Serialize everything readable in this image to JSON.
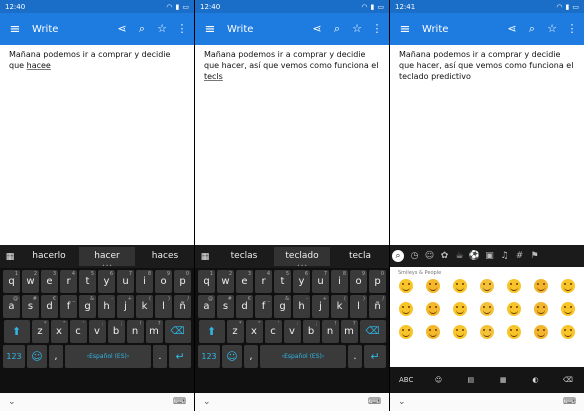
{
  "app": {
    "title": "Write"
  },
  "colors": {
    "statusbar": "#1a6ec8",
    "appbar": "#1e7be0",
    "keyboard": "#101010",
    "key": "#3a3a3a",
    "accent": "#2fb7e6"
  },
  "icons": {
    "menu": "hamburger-menu-icon",
    "share": "share-icon",
    "search": "search-icon",
    "star": "star-icon",
    "more": "more-vert-icon"
  },
  "panels": [
    {
      "time": "12:40",
      "text_prefix": "Mañana podemos ir a comprar y decidie que ",
      "text_last": "hacee",
      "suggestions": [
        "hacerlo",
        "hacer",
        "haces"
      ]
    },
    {
      "time": "12:40",
      "text_prefix": "Mañana podemos ir a comprar y decidie que hacer, así que vemos como funciona el ",
      "text_last": "tecls",
      "suggestions": [
        "teclas",
        "teclado",
        "tecla"
      ]
    },
    {
      "time": "12:41",
      "text_prefix": "Mañana podemos ir a comprar y decidie que hacer, así que vemos como funciona el teclado predictivo",
      "text_last": "",
      "emoji_section": "Smileys & People",
      "emoji_bottom": {
        "abc": "ABC"
      }
    }
  ],
  "keyboard": {
    "row1": [
      {
        "k": "q",
        "s": "1"
      },
      {
        "k": "w",
        "s": "2"
      },
      {
        "k": "e",
        "s": "3"
      },
      {
        "k": "r",
        "s": "4"
      },
      {
        "k": "t",
        "s": "5"
      },
      {
        "k": "y",
        "s": "6"
      },
      {
        "k": "u",
        "s": "7"
      },
      {
        "k": "i",
        "s": "8"
      },
      {
        "k": "o",
        "s": "9"
      },
      {
        "k": "p",
        "s": "0"
      }
    ],
    "row2": [
      {
        "k": "a",
        "s": "@"
      },
      {
        "k": "s",
        "s": "#"
      },
      {
        "k": "d",
        "s": "€"
      },
      {
        "k": "f",
        "s": "_"
      },
      {
        "k": "g",
        "s": "&"
      },
      {
        "k": "h",
        "s": "-"
      },
      {
        "k": "j",
        "s": "+"
      },
      {
        "k": "k",
        "s": "("
      },
      {
        "k": "l",
        "s": ")"
      },
      {
        "k": "ñ",
        "s": "/"
      }
    ],
    "row3": [
      {
        "k": "z",
        "s": "*"
      },
      {
        "k": "x",
        "s": "\""
      },
      {
        "k": "c",
        "s": "'"
      },
      {
        "k": "v",
        "s": ":"
      },
      {
        "k": "b",
        "s": ";"
      },
      {
        "k": "n",
        "s": "!"
      },
      {
        "k": "m",
        "s": "?"
      }
    ],
    "num_label": "123",
    "comma": ",",
    "space_label": "Español (ES)",
    "period": "."
  }
}
